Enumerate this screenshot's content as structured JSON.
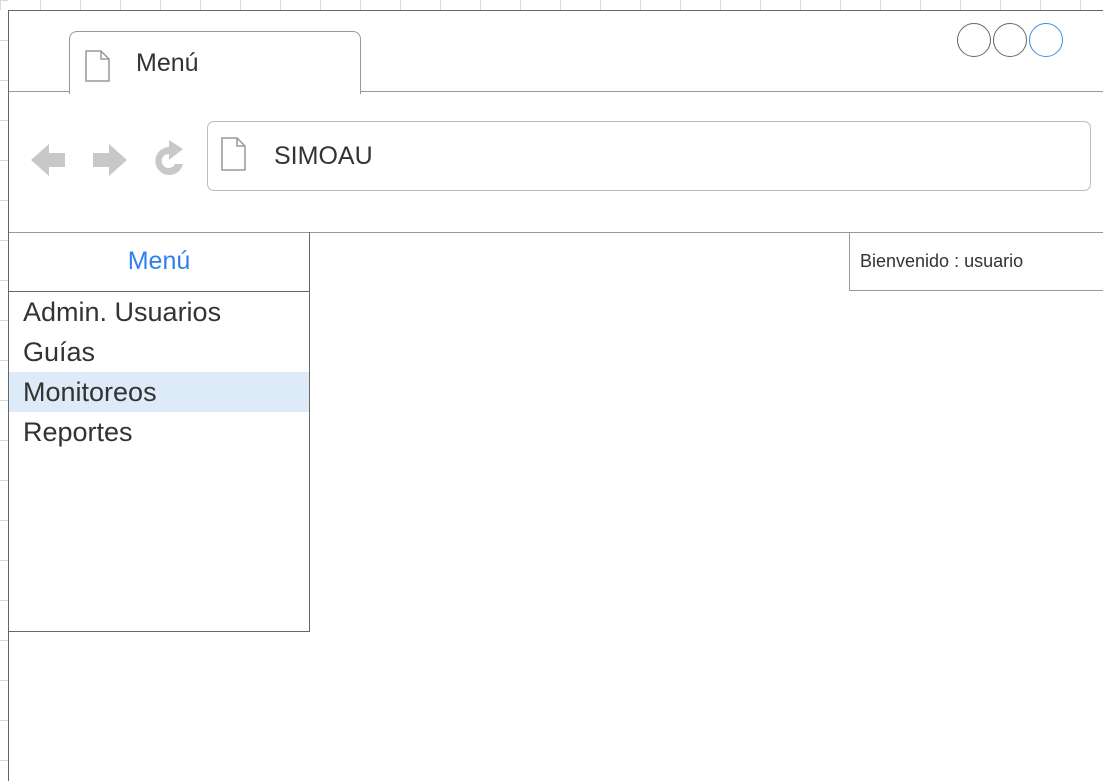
{
  "browser": {
    "tab_title": "Menú",
    "address": "SIMOAU",
    "window_controls": [
      "minimize",
      "maximize",
      "close"
    ]
  },
  "sidebar": {
    "header": "Menú",
    "items": [
      {
        "label": "Admin. Usuarios",
        "selected": false
      },
      {
        "label": "Guías",
        "selected": false
      },
      {
        "label": "Monitoreos",
        "selected": true
      },
      {
        "label": "Reportes",
        "selected": false
      }
    ]
  },
  "header": {
    "welcome": "Bienvenido : usuario"
  },
  "colors": {
    "accent": "#2f80ed",
    "selected_bg": "#ddebf8",
    "icon_gray": "#c8c8c8"
  }
}
